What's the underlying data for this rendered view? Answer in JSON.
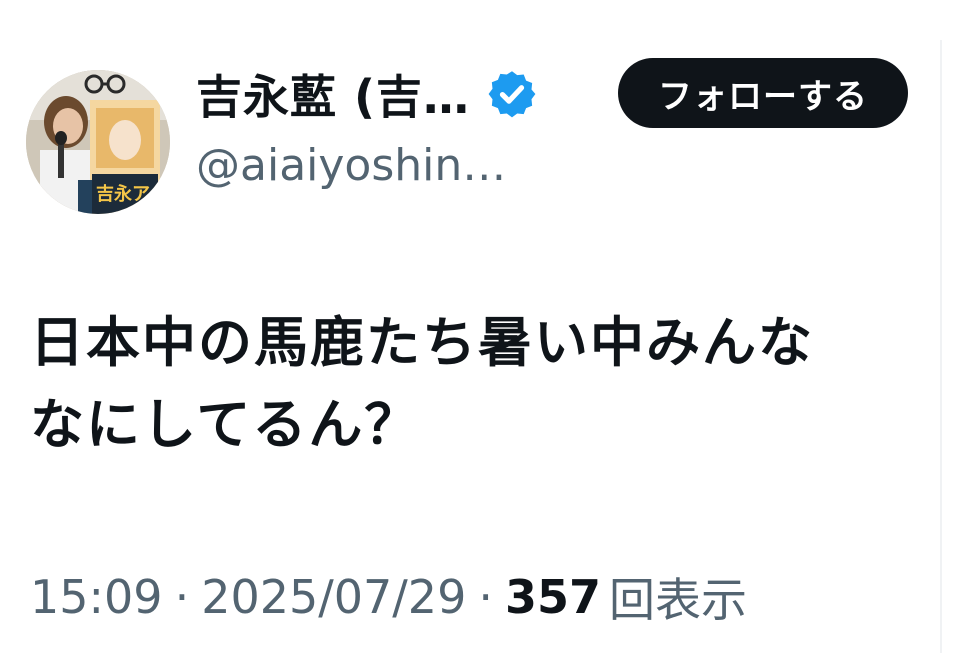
{
  "author": {
    "display_name": "吉永藍 (吉…",
    "handle": "@aiaiyoshin…",
    "verified_icon": "verified-badge-icon",
    "avatar_icon": "profile-photo",
    "avatar_poster_text": "吉永ア"
  },
  "follow_button": {
    "label": "フォローする"
  },
  "tweet": {
    "lines": [
      "日本中の馬鹿たち暑い中みんな",
      "なにしてるん？"
    ]
  },
  "meta": {
    "time": "15:09",
    "separator": "·",
    "date": "2025/07/29",
    "views": "357",
    "views_label": "回表示"
  },
  "colors": {
    "text_primary": "#0f1419",
    "text_secondary": "#536471",
    "verified_blue": "#1d9bf0",
    "button_bg": "#0f1419"
  }
}
